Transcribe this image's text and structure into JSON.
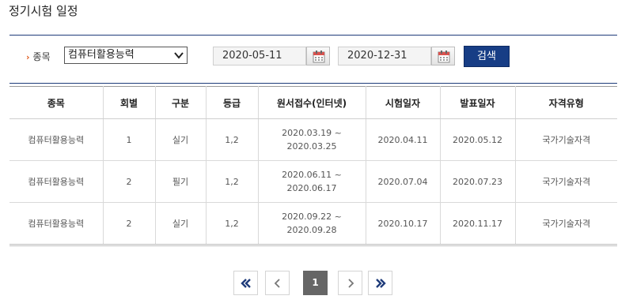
{
  "page": {
    "title": "정기시험 일정"
  },
  "search": {
    "category_label": "종목",
    "category_value": "컴퓨터활용능력",
    "start_date": "2020-05-11",
    "end_date": "2020-12-31",
    "search_button": "검색",
    "accent_color": "#173d85"
  },
  "table": {
    "headers": [
      "종목",
      "회별",
      "구분",
      "등급",
      "원서접수(인터넷)",
      "시험일자",
      "발표일자",
      "자격유형"
    ],
    "rows": [
      {
        "subject": "컴퓨터활용능력",
        "round": "1",
        "type": "실기",
        "grade": "1,2",
        "apply_start": "2020.03.19 ~",
        "apply_end": "2020.03.25",
        "exam_date": "2020.04.11",
        "result_date": "2020.05.12",
        "qualification": "국가기술자격"
      },
      {
        "subject": "컴퓨터활용능력",
        "round": "2",
        "type": "필기",
        "grade": "1,2",
        "apply_start": "2020.06.11 ~",
        "apply_end": "2020.06.17",
        "exam_date": "2020.07.04",
        "result_date": "2020.07.23",
        "qualification": "국가기술자격"
      },
      {
        "subject": "컴퓨터활용능력",
        "round": "2",
        "type": "실기",
        "grade": "1,2",
        "apply_start": "2020.09.22 ~",
        "apply_end": "2020.09.28",
        "exam_date": "2020.10.17",
        "result_date": "2020.11.17",
        "qualification": "국가기술자격"
      }
    ]
  },
  "pagination": {
    "current_page": "1"
  },
  "icons": {
    "first": "double-chevron-left-icon",
    "prev": "chevron-left-icon",
    "next": "chevron-right-icon",
    "last": "double-chevron-right-icon",
    "calendar": "calendar-icon"
  }
}
